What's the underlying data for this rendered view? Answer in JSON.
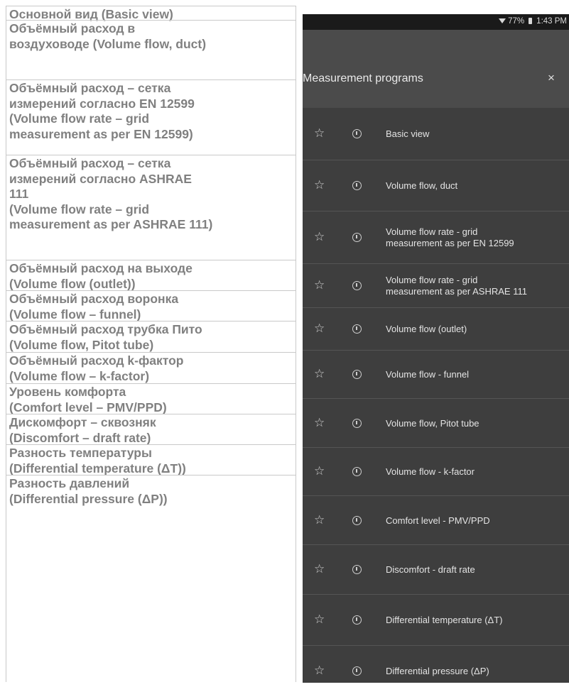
{
  "table": {
    "rows": [
      {
        "lines": [
          "Основной вид (Basic view)"
        ]
      },
      {
        "lines": [
          "Объёмный расход в",
          "воздуховоде (Volume flow, duct)"
        ]
      },
      {
        "lines": [
          "Объёмный расход – сетка",
          "измерений согласно EN 12599",
          "(Volume flow rate – grid",
          "measurement as per EN 12599)"
        ]
      },
      {
        "lines": [
          "Объёмный расход – сетка",
          "измерений согласно ASHRAE",
          "111",
          "(Volume flow rate – grid",
          "measurement as per ASHRAE 111)"
        ]
      },
      {
        "lines": [
          "Объёмный расход на выходе",
          "(Volume flow (outlet))"
        ]
      },
      {
        "lines": [
          "Объёмный расход воронка",
          "(Volume flow – funnel)"
        ]
      },
      {
        "lines": [
          "Объёмный расход трубка Пито",
          "(Volume flow, Pitot tube)"
        ]
      },
      {
        "lines": [
          "Объёмный расход k-фактор",
          "(Volume flow – k-factor)"
        ]
      },
      {
        "lines": [
          "Уровень комфорта",
          "(Comfort level – PMV/PPD)"
        ]
      },
      {
        "lines": [
          "Дискомфорт – сквозняк",
          "(Discomfort – draft rate)"
        ]
      },
      {
        "lines": [
          "Разность температуры",
          "(Differential temperature (ΔT))"
        ]
      },
      {
        "lines": [
          "Разность давлений",
          "(Differential pressure (ΔP))"
        ]
      }
    ]
  },
  "phone": {
    "status": {
      "battery": "77%",
      "time": "1:43 PM"
    },
    "header": {
      "title": "Measurement programs",
      "close": "×"
    },
    "programs": [
      {
        "lines": [
          "Basic view"
        ]
      },
      {
        "lines": [
          "Volume flow, duct"
        ]
      },
      {
        "lines": [
          "Volume flow rate - grid",
          "measurement as per EN 12599"
        ]
      },
      {
        "lines": [
          "Volume flow rate - grid",
          "measurement as per ASHRAE 111"
        ]
      },
      {
        "lines": [
          "Volume flow (outlet)"
        ]
      },
      {
        "lines": [
          "Volume flow - funnel"
        ]
      },
      {
        "lines": [
          "Volume flow, Pitot tube"
        ]
      },
      {
        "lines": [
          "Volume flow - k-factor"
        ]
      },
      {
        "lines": [
          "Comfort level - PMV/PPD"
        ]
      },
      {
        "lines": [
          "Discomfort - draft rate"
        ]
      },
      {
        "lines": [
          "Differential temperature (ΔT)"
        ]
      },
      {
        "lines": [
          "Differential pressure (ΔP)"
        ]
      }
    ],
    "star_icon": "☆",
    "colors": {
      "background": "#3e3e3e",
      "header": "#4b4b4b",
      "status_bar": "#1a1a1a",
      "text": "#e4e4e4"
    }
  }
}
